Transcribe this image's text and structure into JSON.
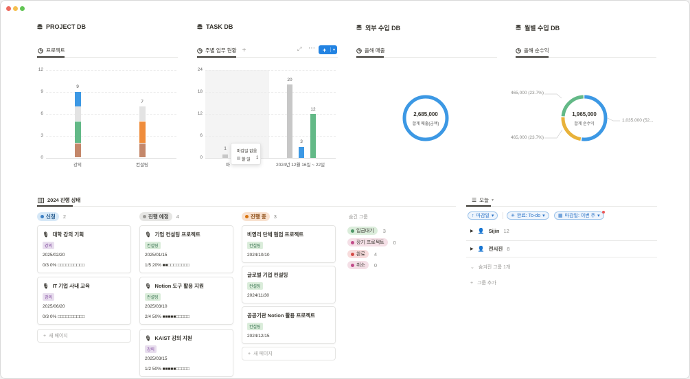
{
  "window": {
    "dots": [
      "#ed6a5e",
      "#f5bf4f",
      "#62c554"
    ]
  },
  "databases": [
    {
      "title": "PROJECT DB",
      "view": "프로젝트"
    },
    {
      "title": "TASK DB",
      "view": "주별 업무 현황"
    },
    {
      "title": "외부 수입 DB",
      "view": "올해 매출"
    },
    {
      "title": "월별 수입 DB",
      "view": "올해 순수익"
    }
  ],
  "project_chart": {
    "y_ticks": [
      "12",
      "9",
      "6",
      "3",
      "0"
    ],
    "bars": [
      {
        "category": "강의",
        "total": "9",
        "segments": [
          {
            "color": "#c4876a",
            "value": 2
          },
          {
            "color": "#63b987",
            "value": 3
          },
          {
            "color": "#e3e3e3",
            "value": 2
          },
          {
            "color": "#3c98e4",
            "value": 2
          }
        ]
      },
      {
        "category": "컨설팅",
        "total": "7",
        "segments": [
          {
            "color": "#c4876a",
            "value": 2
          },
          {
            "color": "#ef8c3b",
            "value": 3
          },
          {
            "color": "#e3e3e3",
            "value": 2
          }
        ]
      }
    ]
  },
  "task_chart": {
    "y_ticks": [
      "24",
      "18",
      "12",
      "6",
      "0"
    ],
    "bars": [
      {
        "label": "1",
        "value": 1,
        "color": "#c7c7c7"
      },
      {
        "label": "20",
        "value": 20,
        "color": "#c7c7c7"
      },
      {
        "label": "3",
        "value": 3,
        "color": "#3c98e4"
      },
      {
        "label": "12",
        "value": 12,
        "color": "#63b987"
      }
    ],
    "x_label_left": "마",
    "x_label_right": "2024년 12월 16일 ~ 22일",
    "tooltip": {
      "title": "마감일 없음",
      "row_label": "할 일",
      "row_value": "1"
    }
  },
  "revenue_chart": {
    "value": "2,685,000",
    "label": "합계 매출(금액)",
    "color": "#3c98e4"
  },
  "profit_chart": {
    "value": "1,965,000",
    "label": "합계 순수익",
    "slices": [
      {
        "value": 1035000,
        "color": "#3c98e4",
        "label": "1,035,000 (52..."
      },
      {
        "value": 465000,
        "color": "#e8b23a",
        "label": "465,000 (23.7%)"
      },
      {
        "value": 465000,
        "color": "#63b987",
        "label": "465,000 (23.7%)"
      }
    ]
  },
  "board": {
    "title": "2024 진행 상태",
    "columns": [
      {
        "name": "신청",
        "count": "2",
        "bg": "#d6e8f7",
        "dot": "#3c7fc4",
        "color": "#24598c"
      },
      {
        "name": "진행 예정",
        "count": "4",
        "bg": "#e6e6e4",
        "dot": "#9b9a97",
        "color": "#4a4a48"
      },
      {
        "name": "진행 중",
        "count": "3",
        "bg": "#f8e1cf",
        "dot": "#d9730d",
        "color": "#8a4a12"
      }
    ],
    "new_page": "새 페이지",
    "hidden_title": "숨긴 그룹",
    "hidden_groups": [
      {
        "name": "입금대기",
        "count": "3",
        "bg": "#dbeddb",
        "dot": "#4f9768"
      },
      {
        "name": "장기 프로젝트",
        "count": "0",
        "bg": "#f4dfe6",
        "dot": "#c14c8a"
      },
      {
        "name": "완료",
        "count": "4",
        "bg": "#f8dcdc",
        "dot": "#d44c47"
      },
      {
        "name": "취소",
        "count": "0",
        "bg": "#f4dfe6",
        "dot": "#c14c8a"
      }
    ],
    "cards": [
      {
        "title": "대학 강의 기획",
        "tag": "강의",
        "date": "2025/02/20",
        "progress": "0/3 0% □□□□□□□□□□"
      },
      {
        "title": "IT 기업 사내 교육",
        "tag": "강의",
        "date": "2025/06/20",
        "progress": "0/3 0% □□□□□□□□□□"
      },
      {
        "title": "기업 컨설팅 프로젝트",
        "tag": "컨설팅",
        "date": "2025/01/15",
        "progress": "1/5 20% ■■□□□□□□□□"
      },
      {
        "title": "Notion 도구 활용 지원",
        "tag": "컨설팅",
        "date": "2025/03/10",
        "progress": "2/4 50% ■■■■■□□□□□"
      },
      {
        "title": "KAIST 강의 지원",
        "tag": "강의",
        "date": "2025/03/15",
        "progress": "1/2 50% ■■■■■□□□□□"
      },
      {
        "title": "비영리 단체 협업 프로젝트",
        "tag": "컨설팅",
        "date": "2024/10/10",
        "progress": ""
      },
      {
        "title": "글로벌 기업 컨설팅",
        "tag": "컨설팅",
        "date": "2024/11/30",
        "progress": ""
      },
      {
        "title": "공공기관 Notion 활용 프로젝트",
        "tag": "컨설팅",
        "date": "2024/12/15",
        "progress": ""
      }
    ]
  },
  "today": {
    "view": "오늘",
    "filters": [
      "마감일",
      "완료: To-do",
      "마감일: 이번 주"
    ],
    "groups": [
      {
        "name": "Sijin",
        "count": "12"
      },
      {
        "name": "전시진",
        "count": "8"
      }
    ],
    "hidden_groups": "숨겨진 그룹 1개",
    "add_group": "그룹 추가"
  }
}
